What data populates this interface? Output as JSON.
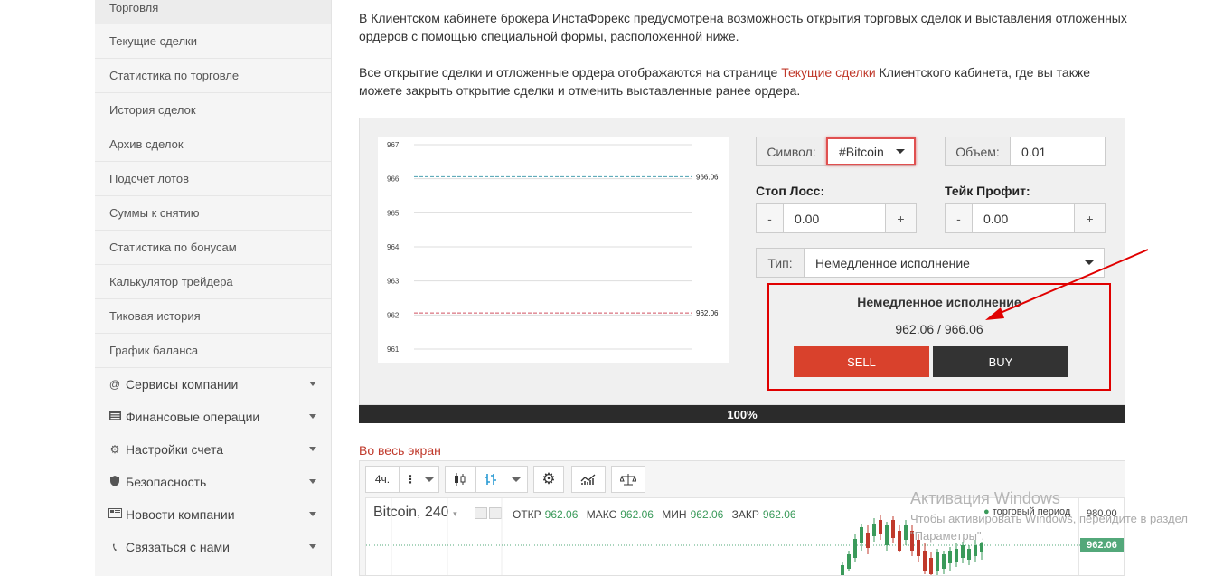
{
  "sidebar": {
    "items": [
      {
        "label": "Торговля"
      },
      {
        "label": "Текущие сделки"
      },
      {
        "label": "Статистика по торговле"
      },
      {
        "label": "История сделок"
      },
      {
        "label": "Архив сделок"
      },
      {
        "label": "Подсчет лотов"
      },
      {
        "label": "Суммы к снятию"
      },
      {
        "label": "Статистика по бонусам"
      },
      {
        "label": "Калькулятор трейдера"
      },
      {
        "label": "Тиковая история"
      },
      {
        "label": "График баланса"
      }
    ],
    "groups": [
      {
        "label": "Сервисы компании",
        "icon": "at-icon"
      },
      {
        "label": "Финансовые операции",
        "icon": "money-icon"
      },
      {
        "label": "Настройки счета",
        "icon": "gear-icon"
      },
      {
        "label": "Безопасность",
        "icon": "shield-icon"
      },
      {
        "label": "Новости компании",
        "icon": "newspaper-icon"
      },
      {
        "label": "Связаться с нами",
        "icon": "phone-icon"
      }
    ]
  },
  "intro": {
    "p1": "В Клиентском кабинете брокера ИнстаФорекс предусмотрена возможность открытия торговых сделок и выставления отложенных ордеров с помощью специальной формы, расположенной ниже.",
    "p2_before": "Все открытие сделки и отложенные ордера отображаются на странице ",
    "p2_link": "Текущие сделки",
    "p2_after": " Клиентского кабинета, где вы также можете закрыть открытие сделки и отменить выставленные ранее ордера."
  },
  "form": {
    "symbol_label": "Символ:",
    "symbol_value": "#Bitcoin",
    "volume_label": "Объем:",
    "volume_value": "0.01",
    "stop_loss_label": "Стоп Лосс:",
    "stop_loss_value": "0.00",
    "take_profit_label": "Тейк Профит:",
    "take_profit_value": "0.00",
    "minus": "-",
    "plus": "+",
    "type_label": "Тип:",
    "type_value": "Немедленное исполнение"
  },
  "execution": {
    "title": "Немедленное исполнение",
    "price": "962.06 / 966.06",
    "sell_label": "SELL",
    "buy_label": "BUY"
  },
  "progress": {
    "label": "100%",
    "value": 100
  },
  "fullscreen_link": "Во весь экран",
  "chart_data": {
    "type": "line",
    "y_ticks": [
      967,
      966,
      965,
      964,
      963,
      962,
      961
    ],
    "ylim": [
      961,
      967
    ],
    "series": [
      {
        "value": 966.06,
        "color": "#4aa0b0",
        "style": "dashed"
      },
      {
        "value": 962.06,
        "color": "#d05060",
        "style": "dashed"
      }
    ],
    "data_labels": [
      "966.06",
      "962.06"
    ]
  },
  "tv": {
    "interval": "4ч.",
    "symbol": "Bitcoin, 240",
    "ohlc": [
      {
        "key": "ОТКР",
        "val": "962.06"
      },
      {
        "key": "МАКС",
        "val": "962.06"
      },
      {
        "key": "МИН",
        "val": "962.06"
      },
      {
        "key": "ЗАКР",
        "val": "962.06"
      }
    ],
    "period_label": "торговый период",
    "price_top": "980.00",
    "price_last": "962.06",
    "up_color": "#3a9a5a",
    "down_color": "#c0392b"
  },
  "windows": {
    "title": "Активация Windows",
    "text": "Чтобы активировать Windows, перейдите в раздел \"Параметры\"."
  }
}
